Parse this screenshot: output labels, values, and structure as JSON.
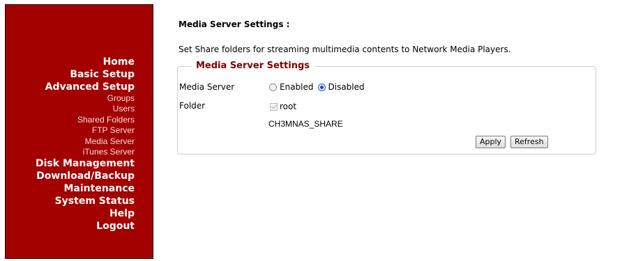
{
  "sidebar": {
    "items": [
      {
        "label": "Home",
        "level": "top"
      },
      {
        "label": "Basic Setup",
        "level": "top"
      },
      {
        "label": "Advanced Setup",
        "level": "top"
      },
      {
        "label": "Groups",
        "level": "sub"
      },
      {
        "label": "Users",
        "level": "sub"
      },
      {
        "label": "Shared Folders",
        "level": "sub"
      },
      {
        "label": "FTP Server",
        "level": "sub"
      },
      {
        "label": "Media Server",
        "level": "sub"
      },
      {
        "label": "iTunes Server",
        "level": "sub"
      },
      {
        "label": "Disk Management",
        "level": "top"
      },
      {
        "label": "Download/Backup",
        "level": "top"
      },
      {
        "label": "Maintenance",
        "level": "top"
      },
      {
        "label": "System Status",
        "level": "top"
      },
      {
        "label": "Help",
        "level": "top"
      },
      {
        "label": "Logout",
        "level": "top"
      }
    ],
    "background_color": "#a30000"
  },
  "main": {
    "title": "Media Server Settings :",
    "description": "Set Share folders for streaming multimedia contents to Network Media Players.",
    "fieldset": {
      "legend": "Media Server Settings",
      "legend_color": "#7a0000",
      "media_server": {
        "label": "Media Server",
        "options": [
          "Enabled",
          "Disabled"
        ],
        "selected": "Disabled"
      },
      "folder": {
        "label": "Folder",
        "checkbox_label": "root",
        "checked": true,
        "disabled": true,
        "share_name": "CH3MNAS_SHARE"
      },
      "buttons": {
        "apply": "Apply",
        "refresh": "Refresh"
      }
    }
  }
}
